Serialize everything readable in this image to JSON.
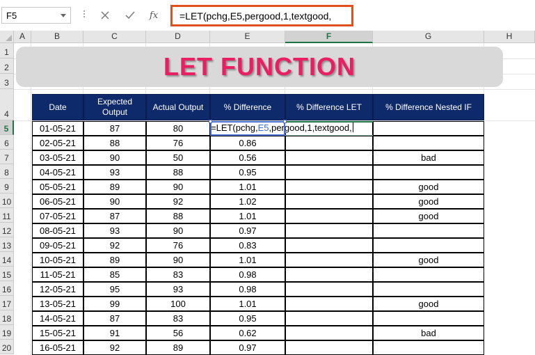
{
  "name_box": {
    "value": "F5"
  },
  "formula_bar": {
    "cancel_icon": "close-icon",
    "enter_icon": "check-icon",
    "function_label": "fx",
    "formula": "=LET(pchg,E5,pergood,1,textgood,"
  },
  "columns": [
    "A",
    "B",
    "C",
    "D",
    "E",
    "F",
    "G",
    "H"
  ],
  "active_column": "F",
  "rows": [
    "1",
    "2",
    "3",
    "4",
    "5",
    "6",
    "7",
    "8",
    "9",
    "10",
    "11",
    "12",
    "13",
    "14",
    "15",
    "16",
    "17",
    "18",
    "19",
    "20"
  ],
  "active_row": "5",
  "banner": {
    "title": "LET FUNCTION"
  },
  "table": {
    "headers": [
      "Date",
      "Expected Output",
      "Actual Output",
      "% Difference",
      "% Difference LET",
      "% Difference Nested IF"
    ],
    "rows": [
      {
        "row": "5",
        "date": "01-05-21",
        "expected": "87",
        "actual": "80",
        "pct": "",
        "let": "",
        "nested": ""
      },
      {
        "row": "6",
        "date": "02-05-21",
        "expected": "88",
        "actual": "76",
        "pct": "0.86",
        "let": "",
        "nested": ""
      },
      {
        "row": "7",
        "date": "03-05-21",
        "expected": "90",
        "actual": "50",
        "pct": "0.56",
        "let": "",
        "nested": "bad"
      },
      {
        "row": "8",
        "date": "04-05-21",
        "expected": "93",
        "actual": "88",
        "pct": "0.95",
        "let": "",
        "nested": ""
      },
      {
        "row": "9",
        "date": "05-05-21",
        "expected": "89",
        "actual": "90",
        "pct": "1.01",
        "let": "",
        "nested": "good"
      },
      {
        "row": "10",
        "date": "06-05-21",
        "expected": "90",
        "actual": "92",
        "pct": "1.02",
        "let": "",
        "nested": "good"
      },
      {
        "row": "11",
        "date": "07-05-21",
        "expected": "87",
        "actual": "88",
        "pct": "1.01",
        "let": "",
        "nested": "good"
      },
      {
        "row": "12",
        "date": "08-05-21",
        "expected": "93",
        "actual": "90",
        "pct": "0.97",
        "let": "",
        "nested": ""
      },
      {
        "row": "13",
        "date": "09-05-21",
        "expected": "92",
        "actual": "76",
        "pct": "0.83",
        "let": "",
        "nested": ""
      },
      {
        "row": "14",
        "date": "10-05-21",
        "expected": "89",
        "actual": "90",
        "pct": "1.01",
        "let": "",
        "nested": "good"
      },
      {
        "row": "15",
        "date": "11-05-21",
        "expected": "85",
        "actual": "83",
        "pct": "0.98",
        "let": "",
        "nested": ""
      },
      {
        "row": "16",
        "date": "12-05-21",
        "expected": "95",
        "actual": "93",
        "pct": "0.98",
        "let": "",
        "nested": ""
      },
      {
        "row": "17",
        "date": "13-05-21",
        "expected": "99",
        "actual": "100",
        "pct": "1.01",
        "let": "",
        "nested": "good"
      },
      {
        "row": "18",
        "date": "14-05-21",
        "expected": "87",
        "actual": "83",
        "pct": "0.95",
        "let": "",
        "nested": ""
      },
      {
        "row": "19",
        "date": "15-05-21",
        "expected": "91",
        "actual": "56",
        "pct": "0.62",
        "let": "",
        "nested": "bad"
      },
      {
        "row": "20",
        "date": "16-05-21",
        "expected": "92",
        "actual": "89",
        "pct": "0.97",
        "let": "",
        "nested": ""
      }
    ]
  },
  "edit": {
    "prefix": "=LET(pchg,",
    "ref": "E5",
    "suffix": ",pergood,1,textgood,"
  },
  "colors": {
    "header_fill": "#0f2a6b",
    "title": "#ea1e63",
    "highlight_border": "#e0501f",
    "active_green": "#217346",
    "ref_blue": "#3a6fd8"
  }
}
